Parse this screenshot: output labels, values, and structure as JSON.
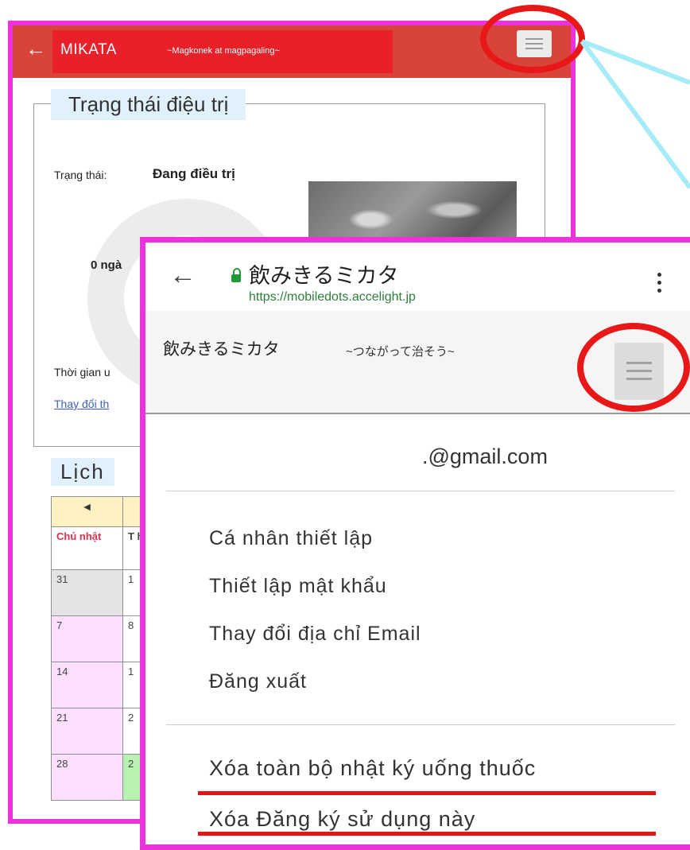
{
  "back_screen": {
    "app_title": "MIKATA",
    "app_subtitle": "~Magkonek at magpagaling~",
    "panel_title": "Trạng thái điệu trị",
    "status_label": "Trạng thái:",
    "status_value": "Đang điều trị",
    "days_text": "0 ngà",
    "time_label": "Thời gian u",
    "change_link": "Thay đổi th",
    "calendar_title": "Lịch",
    "calendar": {
      "nav_prev": "◄",
      "header": [
        "Chủ nhật",
        "T h"
      ],
      "weeks": [
        [
          "31",
          "1"
        ],
        [
          "7",
          "8"
        ],
        [
          "14",
          "1"
        ],
        [
          "21",
          "2"
        ],
        [
          "28",
          "2"
        ]
      ]
    }
  },
  "front_screen": {
    "browser": {
      "page_title": "飲みきるミカタ",
      "url": "https://mobiledots.accelight.jp"
    },
    "site_title": "飲みきるミカタ",
    "site_subtitle": "~つながって治そう~",
    "account_email": ".@gmail.com",
    "menu_items": [
      "Cá nhân thiết lập",
      "Thiết lập mật khẩu",
      "Thay đổi địa chỉ Email",
      "Đăng xuất"
    ],
    "danger_items": [
      "Xóa toàn bộ nhật ký uống thuốc",
      "Xóa Đăng ký sử dụng này"
    ]
  },
  "colors": {
    "frame": "#ea33dc",
    "app_bar": "#d9443a",
    "highlight_ring": "#e81818",
    "connector": "#a6ecf7",
    "lock": "#1f9a37"
  },
  "icons": [
    "back-arrow-icon",
    "menu-icon",
    "lock-icon",
    "overflow-menu-icon"
  ]
}
